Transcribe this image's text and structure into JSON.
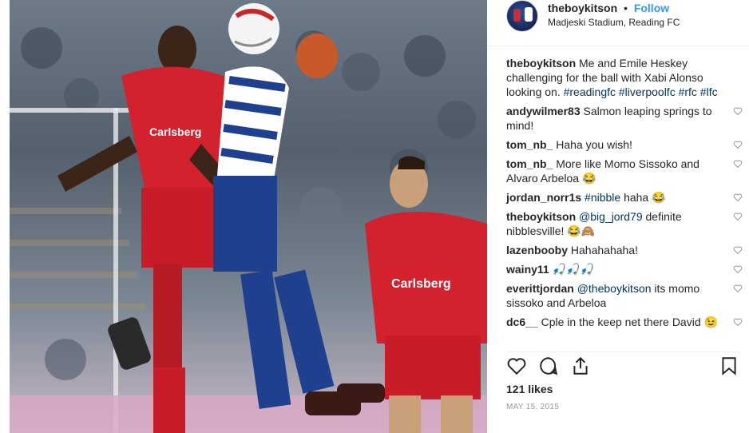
{
  "post": {
    "username": "theboykitson",
    "separator": "•",
    "follow_label": "Follow",
    "location": "Madjeski Stadium, Reading FC",
    "caption": {
      "user": "theboykitson",
      "text_1": "Me and Emile Heskey challenging for the ball with Xabi Alonso looking on.",
      "tags": "#readingfc #liverpoolfc #rfc #lfc"
    },
    "comments": [
      {
        "user": "andywilmer83",
        "text": "Salmon leaping springs to mind!"
      },
      {
        "user": "tom_nb_",
        "text": "Haha you wish!"
      },
      {
        "user": "tom_nb_",
        "text": "More like Momo Sissoko and Alvaro Arbeloa 😂"
      },
      {
        "user": "jordan_norr1s",
        "mention": "#nibble",
        "text": "haha 😂"
      },
      {
        "user": "theboykitson",
        "mention": "@big_jord79",
        "text": "definite nibblesville! 😂🙈"
      },
      {
        "user": "lazenbooby",
        "text": "Hahahahaha!"
      },
      {
        "user": "wainy11",
        "text": "🎣🎣🎣"
      },
      {
        "user": "everittjordan",
        "mention": "@theboykitson",
        "text": "its momo sissoko and Arbeloa"
      },
      {
        "user": "dc6__",
        "text": "Cple in the keep net there David 😉"
      }
    ],
    "likes": "121 likes",
    "date": "MAY 15, 2015",
    "icons": {
      "like": "heart-icon",
      "comment": "comment-icon",
      "share": "share-icon",
      "save": "bookmark-icon",
      "comment_like": "small-heart-icon"
    },
    "colors": {
      "link_blue": "#3897f0",
      "hashtag": "#003569",
      "liverpool_red": "#d3212d",
      "reading_blue": "#1f3f8f"
    }
  }
}
